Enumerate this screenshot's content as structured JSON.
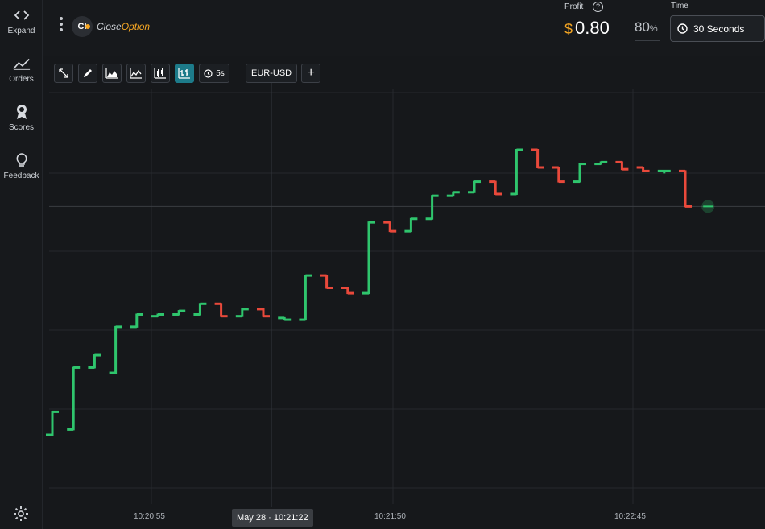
{
  "sidebar": {
    "items": [
      {
        "label": "Expand",
        "icon": "expand-icon"
      },
      {
        "label": "Orders",
        "icon": "orders-icon"
      },
      {
        "label": "Scores",
        "icon": "scores-icon"
      },
      {
        "label": "Feedback",
        "icon": "feedback-icon"
      }
    ],
    "settings_icon": "gear-icon"
  },
  "header": {
    "brand": {
      "mark": "CI",
      "name_part1": "Close",
      "name_part2": "Option"
    },
    "profit": {
      "label": "Profit",
      "currency_symbol": "$",
      "value": "0.80"
    },
    "payout": {
      "value": "80",
      "unit": "%"
    },
    "time": {
      "label": "Time",
      "selected": "30 Seconds"
    }
  },
  "toolbar": {
    "timer_label": "5s",
    "pair_label": "EUR-USD",
    "add_label": "+"
  },
  "chart": {
    "time_ticks": [
      "10:20:55",
      "10:21:50",
      "10:22:45"
    ],
    "cursor_time": "May 28 · 10:21:22",
    "colors": {
      "up": "#2fc56d",
      "down": "#e9493b",
      "grid": "#26292e",
      "background": "#16181b"
    }
  },
  "chart_data": {
    "type": "ohlc",
    "bars": [
      {
        "o": 0.05,
        "c": 0.18,
        "dir": "up"
      },
      {
        "o": 0.08,
        "c": 0.43,
        "dir": "up"
      },
      {
        "o": 0.43,
        "c": 0.5,
        "dir": "up"
      },
      {
        "o": 0.4,
        "c": 0.66,
        "dir": "up"
      },
      {
        "o": 0.66,
        "c": 0.73,
        "dir": "up"
      },
      {
        "o": 0.72,
        "c": 0.73,
        "dir": "up"
      },
      {
        "o": 0.73,
        "c": 0.75,
        "dir": "up"
      },
      {
        "o": 0.73,
        "c": 0.79,
        "dir": "up"
      },
      {
        "o": 0.79,
        "c": 0.72,
        "dir": "down"
      },
      {
        "o": 0.72,
        "c": 0.76,
        "dir": "up"
      },
      {
        "o": 0.76,
        "c": 0.72,
        "dir": "down"
      },
      {
        "o": 0.71,
        "c": 0.7,
        "dir": "up"
      },
      {
        "o": 0.7,
        "c": 0.95,
        "dir": "up"
      },
      {
        "o": 0.95,
        "c": 0.88,
        "dir": "down"
      },
      {
        "o": 0.88,
        "c": 0.85,
        "dir": "down"
      },
      {
        "o": 0.85,
        "c": 1.25,
        "dir": "up"
      },
      {
        "o": 1.25,
        "c": 1.2,
        "dir": "down"
      },
      {
        "o": 1.2,
        "c": 1.27,
        "dir": "up"
      },
      {
        "o": 1.27,
        "c": 1.4,
        "dir": "up"
      },
      {
        "o": 1.4,
        "c": 1.42,
        "dir": "up"
      },
      {
        "o": 1.42,
        "c": 1.48,
        "dir": "up"
      },
      {
        "o": 1.48,
        "c": 1.41,
        "dir": "down"
      },
      {
        "o": 1.41,
        "c": 1.66,
        "dir": "up"
      },
      {
        "o": 1.66,
        "c": 1.56,
        "dir": "down"
      },
      {
        "o": 1.56,
        "c": 1.48,
        "dir": "down"
      },
      {
        "o": 1.48,
        "c": 1.58,
        "dir": "up"
      },
      {
        "o": 1.58,
        "c": 1.59,
        "dir": "up"
      },
      {
        "o": 1.59,
        "c": 1.55,
        "dir": "down"
      },
      {
        "o": 1.56,
        "c": 1.54,
        "dir": "down"
      },
      {
        "o": 1.54,
        "c": 1.54,
        "dir": "up"
      },
      {
        "o": 1.54,
        "c": 1.34,
        "dir": "down"
      }
    ],
    "current": 1.34
  }
}
